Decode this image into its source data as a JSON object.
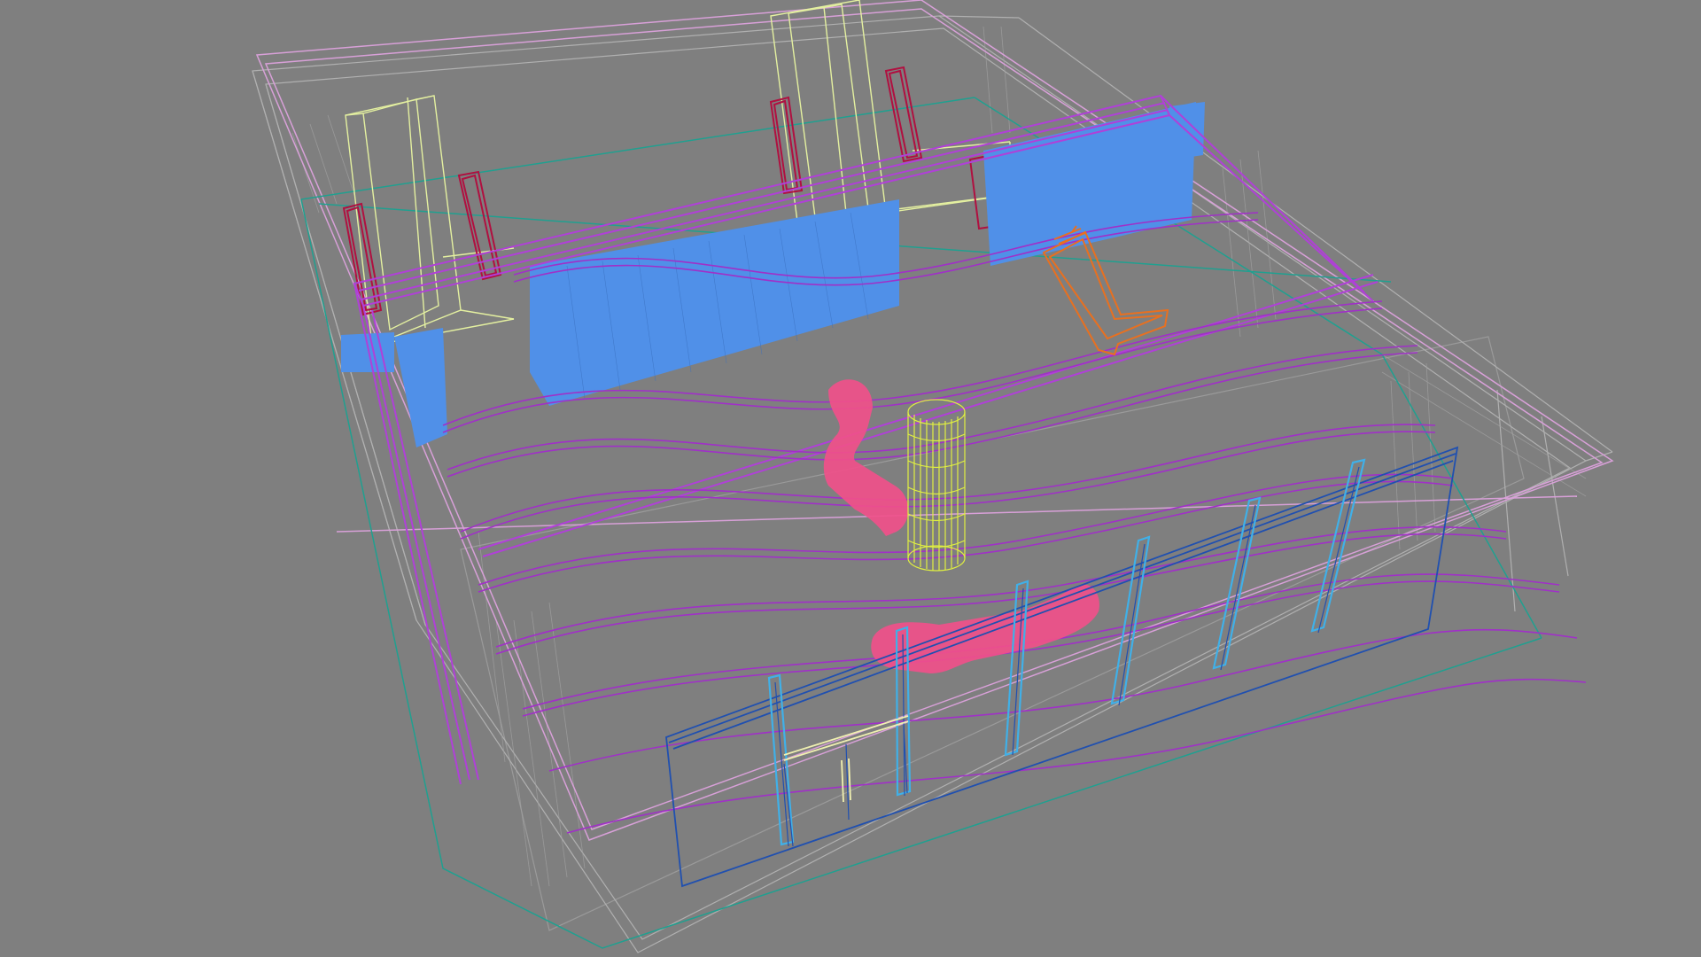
{
  "viewport": {
    "type": "3d-wireframe-perspective",
    "background": "#7f7f7f",
    "shading": "wireframe",
    "objects": [
      {
        "name": "building-shell-outer",
        "color": "#b8b8b8"
      },
      {
        "name": "roof-parapet",
        "color": "#d8a8d8"
      },
      {
        "name": "floor-slab-edge",
        "color": "#20a090"
      },
      {
        "name": "interior-grid",
        "color": "#9a9a9a"
      },
      {
        "name": "ceiling-light-boxes",
        "color": "#e8f0a0"
      },
      {
        "name": "roof-beam-main",
        "color": "#b040d8"
      },
      {
        "name": "wavy-ceiling-slats",
        "color": "#a030c8"
      },
      {
        "name": "acoustic-panel-left",
        "color": "#5090e8"
      },
      {
        "name": "acoustic-panel-right",
        "color": "#5090e8"
      },
      {
        "name": "dark-red-doors",
        "color": "#b01040"
      },
      {
        "name": "orange-bench",
        "color": "#e87020"
      },
      {
        "name": "pink-sculpture-upper",
        "color": "#f0508a"
      },
      {
        "name": "pink-sculpture-lower",
        "color": "#f0508a"
      },
      {
        "name": "yellow-cylinder-column",
        "color": "#e0f040"
      },
      {
        "name": "glass-facade-frame",
        "color": "#2050b0"
      },
      {
        "name": "glass-mullions",
        "color": "#40b0e8"
      },
      {
        "name": "entrance-door",
        "color": "#f0f0b0"
      }
    ]
  }
}
